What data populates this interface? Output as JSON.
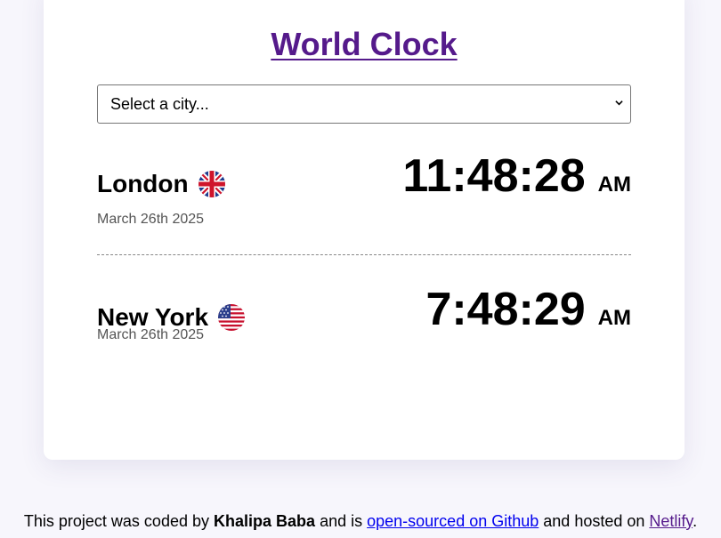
{
  "header": {
    "title": "World Clock"
  },
  "city_select": {
    "selected": "Select a city..."
  },
  "cities": [
    {
      "name": "London",
      "flag_icon": "uk-flag-icon",
      "date": "March 26th 2025",
      "time": "11:48:28",
      "ampm": "AM"
    },
    {
      "name": "New York",
      "flag_icon": "us-flag-icon",
      "date": "March 26th 2025",
      "time": "7:48:29",
      "ampm": "AM"
    }
  ],
  "footer": {
    "prefix": "This project was coded by",
    "author": "Khalipa Baba",
    "middle": "and is",
    "github_link": "open-sourced on Github",
    "hosted": "and hosted on",
    "netlify_link": "Netlify",
    "suffix": "."
  },
  "colors": {
    "page_background": "#f7f6fc",
    "card_background": "#ffffff",
    "title_link": "#551a8b",
    "github_link": "#0000ee",
    "netlify_link": "#551a8b"
  }
}
